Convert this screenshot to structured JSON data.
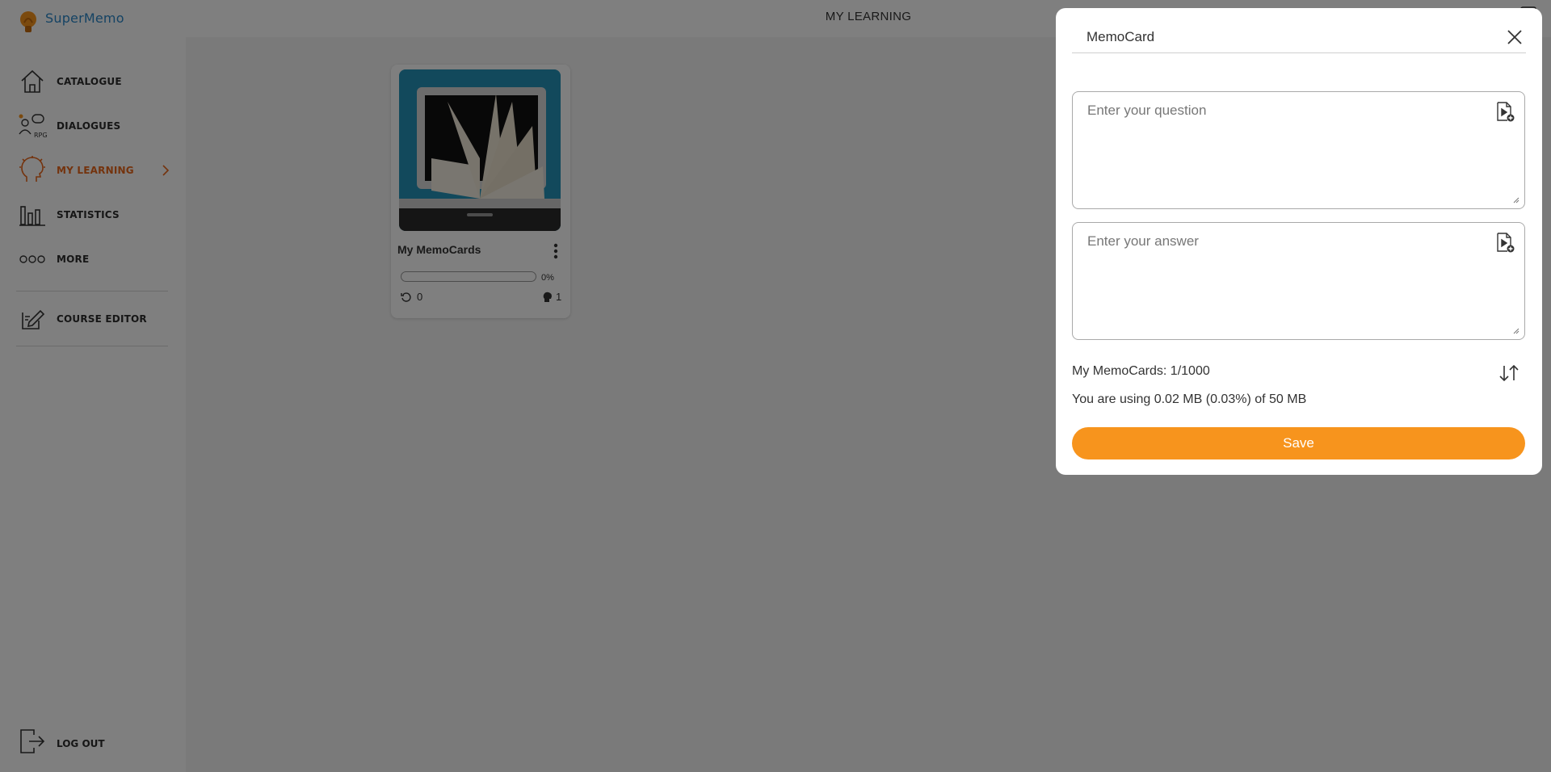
{
  "app": {
    "name": "SuperMemo",
    "accent": "#f7941d",
    "active_color": "#e8661b"
  },
  "sidebar": {
    "items": [
      {
        "label": "CATALOGUE",
        "icon": "home-icon",
        "active": false
      },
      {
        "label": "DIALOGUES",
        "icon": "rpg-dialogues-icon",
        "active": false
      },
      {
        "label": "MY LEARNING",
        "icon": "lightbulb-head-icon",
        "active": true
      },
      {
        "label": "STATISTICS",
        "icon": "bar-chart-icon",
        "active": false
      },
      {
        "label": "MORE",
        "icon": "more-circles-icon",
        "active": false
      }
    ],
    "course_editor": {
      "label": "COURSE EDITOR",
      "icon": "edit-icon"
    },
    "logout": {
      "label": "LOG OUT",
      "icon": "logout-icon"
    }
  },
  "header": {
    "title": "MY LEARNING"
  },
  "course_card": {
    "title": "My MemoCards",
    "progress_percent": 0,
    "progress_label": "0%",
    "repetitions": "0",
    "items": "1"
  },
  "modal": {
    "title": "MemoCard",
    "question_placeholder": "Enter your question",
    "answer_placeholder": "Enter your answer",
    "count_text": "My MemoCards: 1/1000",
    "usage_text": "You are using 0.02 MB (0.03%) of 50 MB",
    "save_label": "Save"
  }
}
